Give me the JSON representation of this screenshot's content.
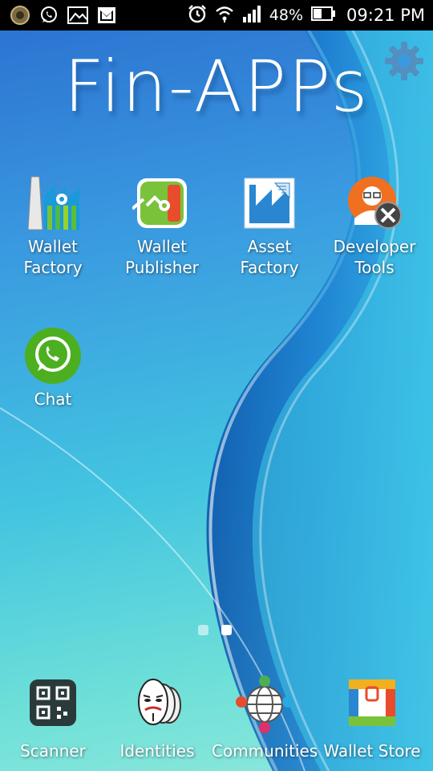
{
  "status_bar": {
    "battery": "48%",
    "time": "09:21 PM",
    "left_icons": [
      "app-badge-icon",
      "whatsapp-notification-icon",
      "gallery-notification-icon",
      "email-notification-icon"
    ],
    "right_icons": [
      "alarm-icon",
      "wifi-icon",
      "signal-icon",
      "battery-icon"
    ]
  },
  "header": {
    "title": "Fin-APPs",
    "settings_icon": "gear-icon"
  },
  "apps": [
    {
      "label": "Wallet\nFactory",
      "icon": "wallet-factory-icon"
    },
    {
      "label": "Wallet\nPublisher",
      "icon": "wallet-publisher-icon"
    },
    {
      "label": "Asset\nFactory",
      "icon": "asset-factory-icon"
    },
    {
      "label": "Developer\nTools",
      "icon": "developer-tools-icon"
    },
    {
      "label": "Chat",
      "icon": "chat-icon"
    }
  ],
  "page_indicator": {
    "pages": 2,
    "current": 2
  },
  "dock": [
    {
      "label": "Scanner",
      "icon": "qr-scanner-icon"
    },
    {
      "label": "Identities",
      "icon": "identities-mask-icon"
    },
    {
      "label": "Communities",
      "icon": "communities-globe-icon"
    },
    {
      "label": "Wallet Store",
      "icon": "wallet-store-icon"
    }
  ],
  "colors": {
    "status_bar": "#000000",
    "wallpaper_top": "#2a6fd0",
    "wallpaper_bottom": "#8ee8dc",
    "chat_green": "#4caf20",
    "developer_orange": "#f07020"
  }
}
